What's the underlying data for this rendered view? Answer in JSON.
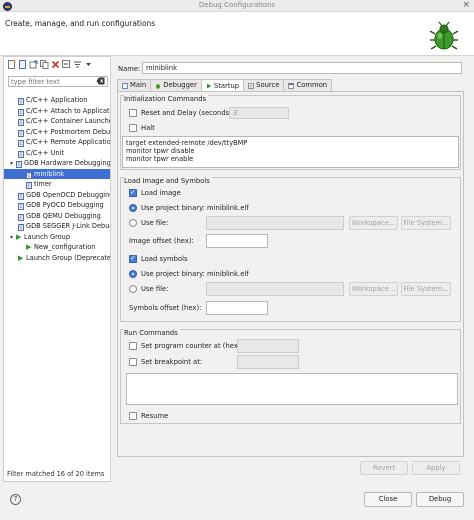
{
  "window": {
    "title": "Debug Configurations",
    "close": "×"
  },
  "header": {
    "title": "Create, manage, and run configurations"
  },
  "sidebar": {
    "filter_placeholder": "type filter text",
    "items": [
      {
        "label": "C/C++ Application",
        "level": 1
      },
      {
        "label": "C/C++ Attach to Application",
        "level": 1
      },
      {
        "label": "C/C++ Container Launcher",
        "level": 1
      },
      {
        "label": "C/C++ Postmortem Debugger",
        "level": 1
      },
      {
        "label": "C/C++ Remote Application",
        "level": 1
      },
      {
        "label": "C/C++ Unit",
        "level": 1
      },
      {
        "label": "GDB Hardware Debugging",
        "level": 1,
        "expanded": true
      },
      {
        "label": "miniblink",
        "level": 2,
        "selected": true
      },
      {
        "label": "timer",
        "level": 2
      },
      {
        "label": "GDB OpenOCD Debugging",
        "level": 1
      },
      {
        "label": "GDB PyOCD Debugging",
        "level": 1
      },
      {
        "label": "GDB QEMU Debugging",
        "level": 1
      },
      {
        "label": "GDB SEGGER J-Link Debugging",
        "level": 1
      },
      {
        "label": "Launch Group",
        "level": 1,
        "expanded": true
      },
      {
        "label": "New_configuration",
        "level": 2
      },
      {
        "label": "Launch Group (Deprecated)",
        "level": 1
      }
    ],
    "filter_status": "Filter matched 16 of 20 items"
  },
  "config": {
    "name_label": "Name:",
    "name_value": "miniblink",
    "tabs": [
      {
        "label": "Main",
        "active": false
      },
      {
        "label": "Debugger",
        "active": false
      },
      {
        "label": "Startup",
        "active": true
      },
      {
        "label": "Source",
        "active": false
      },
      {
        "label": "Common",
        "active": false
      }
    ]
  },
  "init": {
    "title": "Initialization Commands",
    "reset_label": "Reset and Delay (seconds):",
    "reset_value": "3",
    "halt_label": "Halt",
    "commands": "target extended-remote /dev/ttyBMP\nmonitor tpwr disable\nmonitor tpwr enable"
  },
  "load": {
    "title": "Load Image and Symbols",
    "load_image_label": "Load image",
    "use_project_binary_label": "Use project binary:",
    "image_binary": "miniblink.elf",
    "use_file_label": "Use file:",
    "workspace_label": "Workspace...",
    "filesystem_label": "File System...",
    "image_offset_label": "Image offset (hex):",
    "load_symbols_label": "Load symbols",
    "symbols_binary": "miniblink.elf",
    "symbols_offset_label": "Symbols offset (hex):"
  },
  "run": {
    "title": "Run Commands",
    "pc_label": "Set program counter at (hex):",
    "bp_label": "Set breakpoint at:",
    "resume_label": "Resume"
  },
  "actions": {
    "revert": "Revert",
    "apply": "Apply",
    "close": "Close",
    "debug": "Debug",
    "help": "?"
  }
}
